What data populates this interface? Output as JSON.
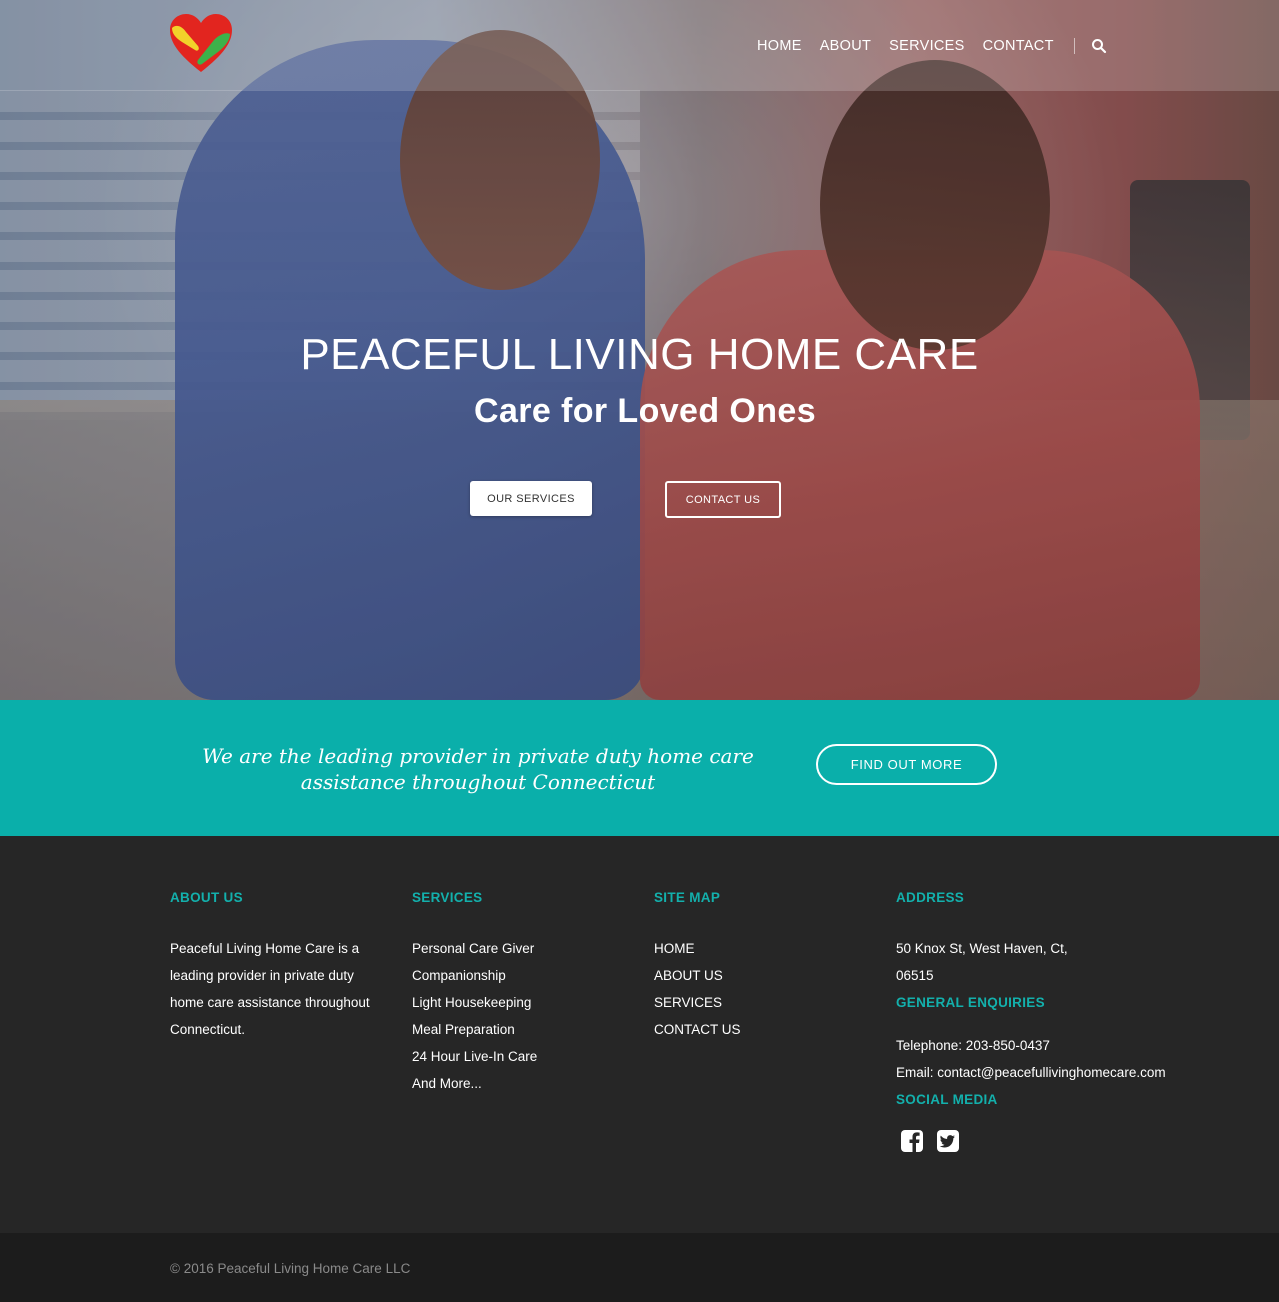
{
  "nav": {
    "items": [
      {
        "label": "HOME"
      },
      {
        "label": "ABOUT"
      },
      {
        "label": "SERVICES"
      },
      {
        "label": "CONTACT"
      }
    ],
    "search_icon": "search-icon"
  },
  "hero": {
    "title": "PEACEFUL LIVING HOME CARE",
    "subtitle": "Care for Loved Ones",
    "primary_button": "OUR SERVICES",
    "secondary_button": "CONTACT US"
  },
  "band": {
    "text": "We are the leading provider in private duty home care assistance throughout Connecticut",
    "button": "FIND OUT MORE",
    "color": "#0aafaa"
  },
  "footer": {
    "about": {
      "heading": "ABOUT US",
      "text": "Peaceful Living Home Care is a leading provider in private duty home care assistance throughout Connecticut."
    },
    "services": {
      "heading": "SERVICES",
      "items": [
        "Personal Care Giver",
        "Companionship",
        "Light Housekeeping",
        "Meal Preparation",
        "24 Hour Live-In Care",
        "And More..."
      ]
    },
    "sitemap": {
      "heading": "SITE MAP",
      "items": [
        "HOME",
        "ABOUT US",
        "SERVICES",
        "CONTACT US"
      ]
    },
    "address": {
      "heading": "ADDRESS",
      "line1": "50 Knox St, West Haven, Ct,",
      "line2": "06515",
      "enquiries_heading": "GENERAL ENQUIRIES",
      "telephone": "Telephone: 203-850-0437",
      "email": "Email: contact@peacefullivinghomecare.com",
      "social_heading": "SOCIAL MEDIA",
      "social_icons": [
        "facebook-icon",
        "twitter-icon"
      ]
    },
    "accent_color": "#13b0ac"
  },
  "copyright": "© 2016 Peaceful Living Home Care LLC"
}
